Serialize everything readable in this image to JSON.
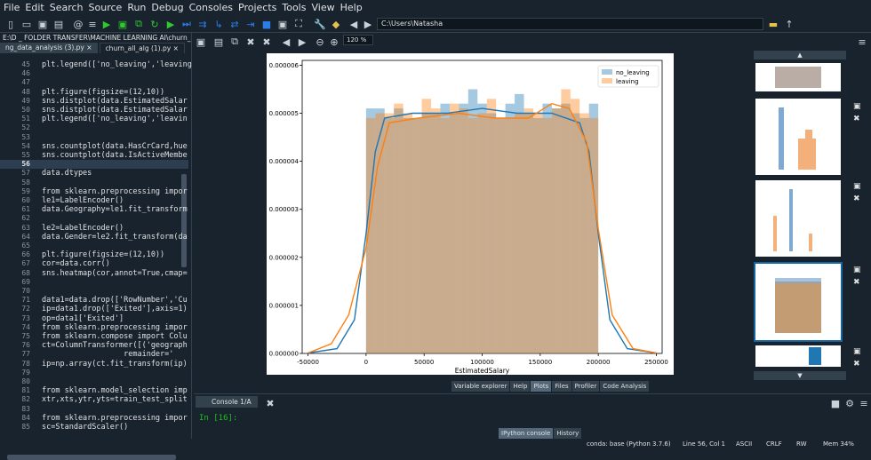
{
  "menu": [
    "File",
    "Edit",
    "Search",
    "Source",
    "Run",
    "Debug",
    "Consoles",
    "Projects",
    "Tools",
    "View",
    "Help"
  ],
  "toolbar": {
    "path": "C:\\Users\\Natasha"
  },
  "editor": {
    "file_path": "E:\\D _ FOLDER TRANSFER\\MACHINE LEARNING AI\\churn_all_alg (1).py",
    "tabs": [
      "ng_data_analysis (3).py",
      "churn_all_alg (1).py"
    ],
    "close_glyph": "×",
    "lines": [
      {
        "n": "45",
        "t": "plt.legend(['no_leaving','leaving"
      },
      {
        "n": "46",
        "t": ""
      },
      {
        "n": "47",
        "t": ""
      },
      {
        "n": "48",
        "t": "plt.figure(figsize=(12,10))"
      },
      {
        "n": "49",
        "t": "sns.distplot(data.EstimatedSalar"
      },
      {
        "n": "50",
        "t": "sns.distplot(data.EstimatedSalar"
      },
      {
        "n": "51",
        "t": "plt.legend(['no_leaving','leavin"
      },
      {
        "n": "52",
        "t": ""
      },
      {
        "n": "53",
        "t": ""
      },
      {
        "n": "54",
        "t": "sns.countplot(data.HasCrCard,hue"
      },
      {
        "n": "55",
        "t": "sns.countplot(data.IsActiveMembe"
      },
      {
        "n": "56",
        "t": ""
      },
      {
        "n": "57",
        "t": "data.dtypes"
      },
      {
        "n": "58",
        "t": ""
      },
      {
        "n": "59",
        "t": "from sklearn.preprocessing impor"
      },
      {
        "n": "60",
        "t": "le1=LabelEncoder()"
      },
      {
        "n": "61",
        "t": "data.Geography=le1.fit_transform"
      },
      {
        "n": "62",
        "t": ""
      },
      {
        "n": "63",
        "t": "le2=LabelEncoder()"
      },
      {
        "n": "64",
        "t": "data.Gender=le2.fit_transform(da"
      },
      {
        "n": "65",
        "t": ""
      },
      {
        "n": "66",
        "t": "plt.figure(figsize=(12,10))"
      },
      {
        "n": "67",
        "t": "cor=data.corr()"
      },
      {
        "n": "68",
        "t": "sns.heatmap(cor,annot=True,cmap="
      },
      {
        "n": "69",
        "t": ""
      },
      {
        "n": "70",
        "t": ""
      },
      {
        "n": "71",
        "t": "data1=data.drop(['RowNumber','Cu"
      },
      {
        "n": "72",
        "t": "ip=data1.drop(['Exited'],axis=1)"
      },
      {
        "n": "73",
        "t": "op=data1['Exited']"
      },
      {
        "n": "74",
        "t": "from sklearn.preprocessing impor"
      },
      {
        "n": "75",
        "t": "from sklearn.compose import Colu"
      },
      {
        "n": "76",
        "t": "ct=ColumnTransformer([('geograph"
      },
      {
        "n": "77",
        "t": "                  remainder='"
      },
      {
        "n": "78",
        "t": "ip=np.array(ct.fit_transform(ip)"
      },
      {
        "n": "79",
        "t": ""
      },
      {
        "n": "80",
        "t": ""
      },
      {
        "n": "81",
        "t": "from sklearn.model_selection imp"
      },
      {
        "n": "82",
        "t": "xtr,xts,ytr,yts=train_test_split"
      },
      {
        "n": "83",
        "t": ""
      },
      {
        "n": "84",
        "t": "from sklearn.preprocessing impor"
      },
      {
        "n": "85",
        "t": "sc=StandardScaler()"
      }
    ]
  },
  "plots": {
    "zoom": "120 %",
    "pane_tabs": [
      "Variable explorer",
      "Help",
      "Plots",
      "Files",
      "Profiler",
      "Code Analysis"
    ],
    "active_tab": "Plots"
  },
  "chart_data": {
    "type": "histogram",
    "xlabel": "EstimatedSalary",
    "xlim": [
      -55000,
      255000
    ],
    "ylim": [
      0,
      6.1e-06
    ],
    "xticks": [
      "-50000",
      "0",
      "50000",
      "100000",
      "150000",
      "200000",
      "250000"
    ],
    "xtick_values": [
      -50000,
      0,
      50000,
      100000,
      150000,
      200000,
      250000
    ],
    "yticks": [
      "0.000000",
      "0.000001",
      "0.000002",
      "0.000003",
      "0.000004",
      "0.000005",
      "0.000006"
    ],
    "ytick_values": [
      0,
      1e-06,
      2e-06,
      3e-06,
      4e-06,
      5e-06,
      6e-06
    ],
    "bin_edges": [
      0,
      8000,
      16000,
      24000,
      32000,
      40000,
      48000,
      56000,
      64000,
      72000,
      80000,
      88000,
      96000,
      104000,
      112000,
      120000,
      128000,
      136000,
      144000,
      152000,
      160000,
      168000,
      176000,
      184000,
      192000,
      200000
    ],
    "series": [
      {
        "name": "no_leaving",
        "color": "#1f77b4",
        "values": [
          5.1e-06,
          5.1e-06,
          4.9e-06,
          5.1e-06,
          4.9e-06,
          4.9e-06,
          5e-06,
          5e-06,
          5.2e-06,
          5e-06,
          5.2e-06,
          5.5e-06,
          5.2e-06,
          5e-06,
          4.9e-06,
          5.2e-06,
          5.4e-06,
          5e-06,
          4.9e-06,
          5.2e-06,
          5.1e-06,
          5.2e-06,
          5e-06,
          4.9e-06,
          5.2e-06
        ],
        "kde": [
          [
            -50000,
            1e-08
          ],
          [
            -25000,
            1e-07
          ],
          [
            -10000,
            7e-07
          ],
          [
            0,
            2.5e-06
          ],
          [
            8000,
            4.2e-06
          ],
          [
            16000,
            4.9e-06
          ],
          [
            40000,
            5e-06
          ],
          [
            70000,
            5e-06
          ],
          [
            100000,
            5.1e-06
          ],
          [
            130000,
            5e-06
          ],
          [
            160000,
            5e-06
          ],
          [
            184000,
            4.8e-06
          ],
          [
            192000,
            4.2e-06
          ],
          [
            200000,
            2.5e-06
          ],
          [
            210000,
            7e-07
          ],
          [
            225000,
            1e-07
          ],
          [
            250000,
            1e-08
          ]
        ]
      },
      {
        "name": "leaving",
        "color": "#ff7f0e",
        "values": [
          4.9e-06,
          5e-06,
          5e-06,
          5.2e-06,
          5e-06,
          4.9e-06,
          5.3e-06,
          5.1e-06,
          4.9e-06,
          5.2e-06,
          5.1e-06,
          4.9e-06,
          5e-06,
          5.3e-06,
          4.9e-06,
          4.9e-06,
          5e-06,
          5.1e-06,
          5e-06,
          4.9e-06,
          5.1e-06,
          5.5e-06,
          5.3e-06,
          5e-06,
          4.9e-06
        ],
        "kde": [
          [
            -50000,
            1e-08
          ],
          [
            -30000,
            2e-07
          ],
          [
            -15000,
            8e-07
          ],
          [
            0,
            2.2e-06
          ],
          [
            10000,
            3.9e-06
          ],
          [
            20000,
            4.8e-06
          ],
          [
            45000,
            4.9e-06
          ],
          [
            80000,
            5e-06
          ],
          [
            110000,
            4.9e-06
          ],
          [
            140000,
            4.9e-06
          ],
          [
            160000,
            5.2e-06
          ],
          [
            175000,
            5.1e-06
          ],
          [
            190000,
            4.4e-06
          ],
          [
            200000,
            2.6e-06
          ],
          [
            212000,
            8e-07
          ],
          [
            230000,
            1e-07
          ],
          [
            250000,
            1e-08
          ]
        ]
      }
    ],
    "legend": "top-right"
  },
  "console": {
    "tab": "Console 1/A",
    "prompt": "In [16]:",
    "tabs": [
      "IPython console",
      "History"
    ]
  },
  "status": {
    "conda": "conda: base (Python 3.7.6)",
    "pos": "Line 56, Col 1",
    "enc": "ASCII",
    "eol": "CRLF",
    "rw": "RW",
    "mem": "Mem 34%"
  }
}
